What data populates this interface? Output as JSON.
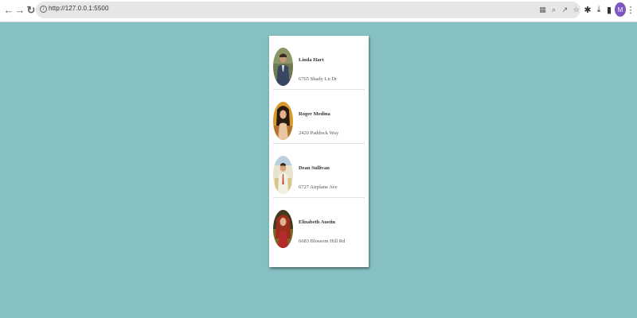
{
  "browser": {
    "url": "http://127.0.0.1:5500",
    "profile_initial": "M",
    "icons": [
      "back-icon",
      "forward-icon",
      "reload-icon",
      "site-info-icon",
      "translate-icon",
      "zoom-icon",
      "share-icon",
      "bookmark-star-icon",
      "extensions-icon",
      "download-icon",
      "side-panel-icon",
      "menu-icon"
    ]
  },
  "users": [
    {
      "name": "Linda Hart",
      "address": "6765 Shady Ln Dr"
    },
    {
      "name": "Roger Medina",
      "address": "2420 Paddock Way"
    },
    {
      "name": "Dean Sullivan",
      "address": "6727 Airplane Ave"
    },
    {
      "name": "Elizabeth Austin",
      "address": "6683 Blossom Hill Rd"
    }
  ],
  "colors": {
    "page_background": "#86c0c2",
    "card_background": "#ffffff",
    "profile_accent": "#7e57c2"
  }
}
